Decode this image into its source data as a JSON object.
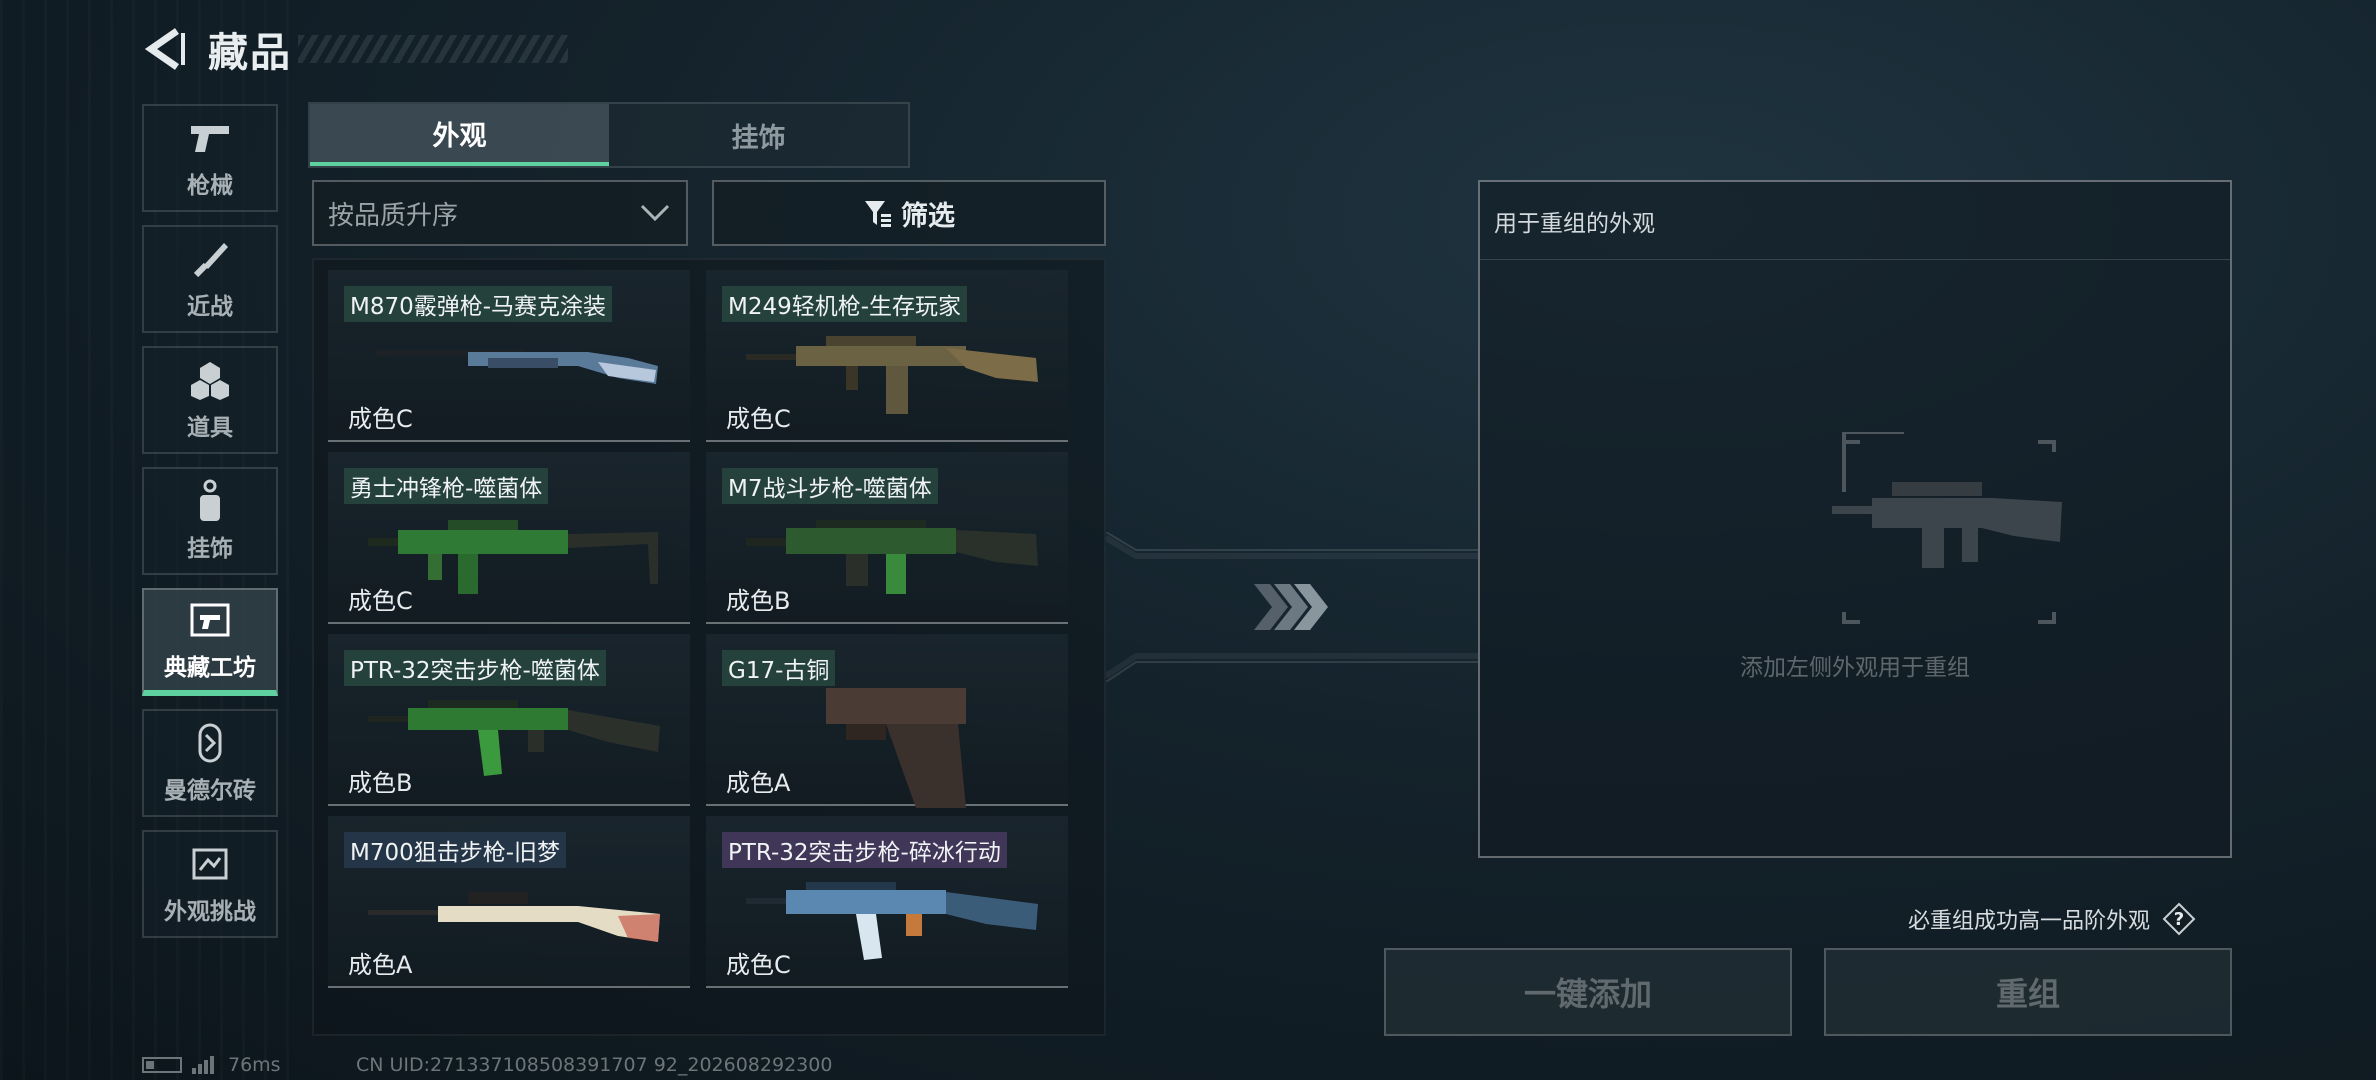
{
  "header": {
    "title": "藏品"
  },
  "sidebar": {
    "items": [
      {
        "label": "枪械",
        "icon": "pistol-icon",
        "active": false
      },
      {
        "label": "近战",
        "icon": "knife-icon",
        "active": false
      },
      {
        "label": "道具",
        "icon": "items-icon",
        "active": false
      },
      {
        "label": "挂饰",
        "icon": "charm-icon",
        "active": false
      },
      {
        "label": "典藏工坊",
        "icon": "workshop-icon",
        "active": true
      },
      {
        "label": "曼德尔砖",
        "icon": "brick-icon",
        "active": false
      },
      {
        "label": "外观挑战",
        "icon": "challenge-icon",
        "active": false
      }
    ]
  },
  "tabs": [
    {
      "label": "外观",
      "active": true
    },
    {
      "label": "挂饰",
      "active": false
    }
  ],
  "sort": {
    "value": "按品质升序"
  },
  "filter": {
    "label": "筛选"
  },
  "skins": [
    {
      "name": "M870霰弹枪-马赛克涂装",
      "grade": "成色C",
      "tag": "green",
      "gun": "shotgun"
    },
    {
      "name": "M249轻机枪-生存玩家",
      "grade": "成色C",
      "tag": "green",
      "gun": "lmg"
    },
    {
      "name": "勇士冲锋枪-噬菌体",
      "grade": "成色C",
      "tag": "green",
      "gun": "smg"
    },
    {
      "name": "M7战斗步枪-噬菌体",
      "grade": "成色B",
      "tag": "green",
      "gun": "rifle"
    },
    {
      "name": "PTR-32突击步枪-噬菌体",
      "grade": "成色B",
      "tag": "green",
      "gun": "ptr"
    },
    {
      "name": "G17-古铜",
      "grade": "成色A",
      "tag": "green",
      "gun": "pistol"
    },
    {
      "name": "M700狙击步枪-旧梦",
      "grade": "成色A",
      "tag": "blue",
      "gun": "sniper"
    },
    {
      "name": "PTR-32突击步枪-碎冰行动",
      "grade": "成色C",
      "tag": "purple",
      "gun": "ptr2"
    }
  ],
  "reroll": {
    "header": "用于重组的外观",
    "placeholder": "添加左侧外观用于重组",
    "note": "必重组成功高一品阶外观",
    "add_all_label": "一键添加",
    "reroll_label": "重组"
  },
  "status": {
    "ping": "76ms",
    "uid": "CN UID:271337108508391707 92_202608292300"
  },
  "colors": {
    "accent": "#5fd0a0",
    "background": "#14222b"
  }
}
